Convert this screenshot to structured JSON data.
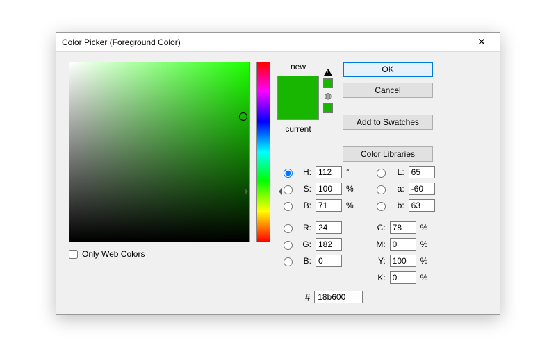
{
  "title": "Color Picker (Foreground Color)",
  "buttons": {
    "ok": "OK",
    "cancel": "Cancel",
    "add_swatches": "Add to Swatches",
    "color_libraries": "Color Libraries"
  },
  "preview": {
    "new_label": "new",
    "current_label": "current",
    "new_hex": "#18b600",
    "current_hex": "#18b600"
  },
  "only_web_colors": {
    "label": "Only Web Colors",
    "checked": false
  },
  "hsb": {
    "H": {
      "label": "H:",
      "value": "112",
      "suffix": "°",
      "selected": true
    },
    "S": {
      "label": "S:",
      "value": "100",
      "suffix": "%",
      "selected": false
    },
    "B": {
      "label": "B:",
      "value": "71",
      "suffix": "%",
      "selected": false
    }
  },
  "rgb": {
    "R": {
      "label": "R:",
      "value": "24",
      "selected": false
    },
    "G": {
      "label": "G:",
      "value": "182",
      "selected": false
    },
    "B": {
      "label": "B:",
      "value": "0",
      "selected": false
    }
  },
  "lab": {
    "L": {
      "label": "L:",
      "value": "65",
      "selected": false
    },
    "a": {
      "label": "a:",
      "value": "-60",
      "selected": false
    },
    "b": {
      "label": "b:",
      "value": "63",
      "selected": false
    }
  },
  "cmyk": {
    "C": {
      "label": "C:",
      "value": "78",
      "suffix": "%"
    },
    "M": {
      "label": "M:",
      "value": "0",
      "suffix": "%"
    },
    "Y": {
      "label": "Y:",
      "value": "100",
      "suffix": "%"
    },
    "K": {
      "label": "K:",
      "value": "0",
      "suffix": "%"
    }
  },
  "hex": {
    "label": "#",
    "value": "18b600"
  }
}
